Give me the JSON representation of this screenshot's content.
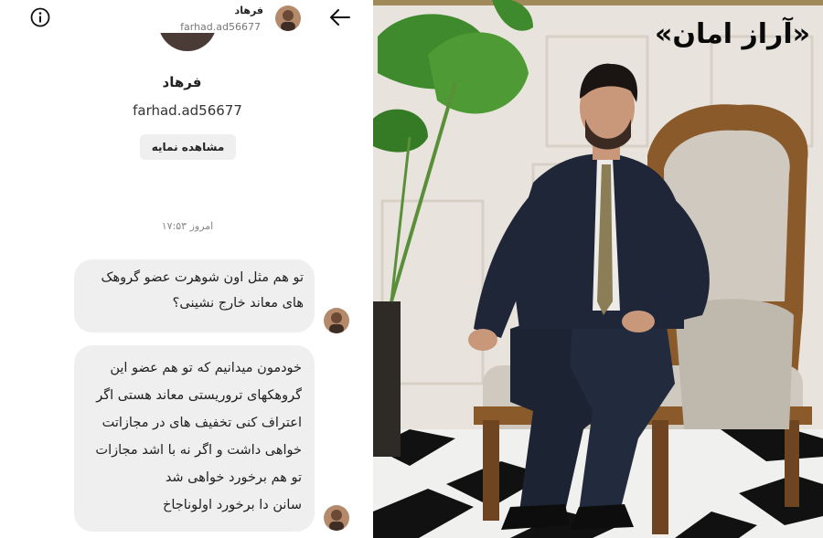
{
  "header": {
    "name": "فرهاد",
    "username": "farhad.ad56677",
    "info_icon": "info-icon",
    "back_icon": "arrow-left-icon"
  },
  "profile": {
    "name": "فرهاد",
    "username": "farhad.ad56677",
    "view_button": "مشاهده نمایه"
  },
  "timestamp": "امروز ۱۷:۵۳",
  "messages": [
    {
      "lines": [
        "تو هم مثل اون شوهرت عضو گروهک",
        "های معاند خارج نشینی؟"
      ]
    },
    {
      "lines": [
        "خودمون میدانیم که تو هم عضو این",
        "گروهکهای تروریستی معاند هستی اگر",
        "اعتراف کنی تخفیف های در مجازاتت",
        "خواهی داشت و اگر نه با اشد مجازات",
        "تو هم برخورد خواهی شد",
        "سانن دا برخورد اولوناجاخ"
      ]
    }
  ],
  "photo": {
    "caption": "«آراز امان»"
  },
  "colors": {
    "bubble": "#efefef",
    "background": "#ffffff",
    "text": "#222222"
  }
}
